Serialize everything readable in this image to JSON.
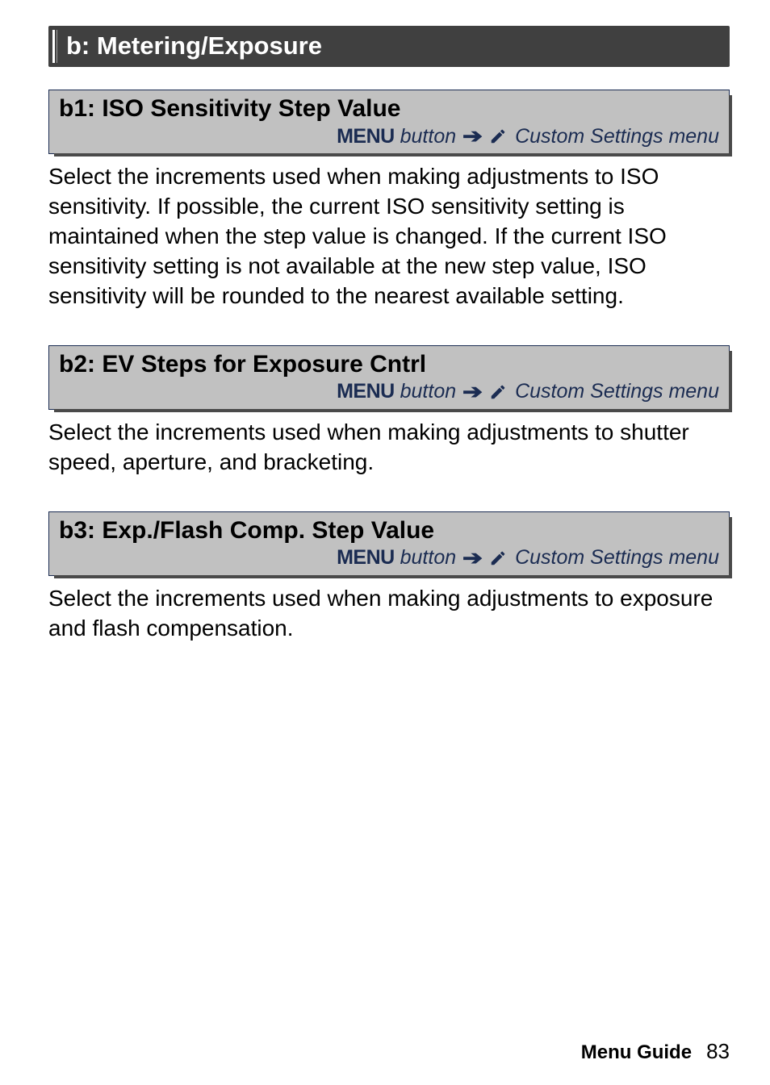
{
  "section": {
    "title": "b: Metering/Exposure"
  },
  "menu_path": {
    "button_label": "MENU",
    "button_word": "button",
    "dest": "Custom Settings menu"
  },
  "b1": {
    "title": "b1: ISO Sensitivity Step Value",
    "body": "Select the increments used when making adjustments to ISO sensitivity.  If possible, the current ISO sensitivity setting is maintained when the step value is changed.  If the current ISO sensitivity setting is not available at the new step value, ISO sensitivity will be rounded to the nearest available setting."
  },
  "b2": {
    "title": "b2: EV Steps for Exposure Cntrl",
    "body": "Select the increments used when making adjustments to shutter speed, aperture, and bracketing."
  },
  "b3": {
    "title": "b3: Exp./Flash Comp. Step Value",
    "body": "Select the increments used when making adjustments to exposure and flash compensation."
  },
  "footer": {
    "label": "Menu Guide",
    "page": "83"
  }
}
